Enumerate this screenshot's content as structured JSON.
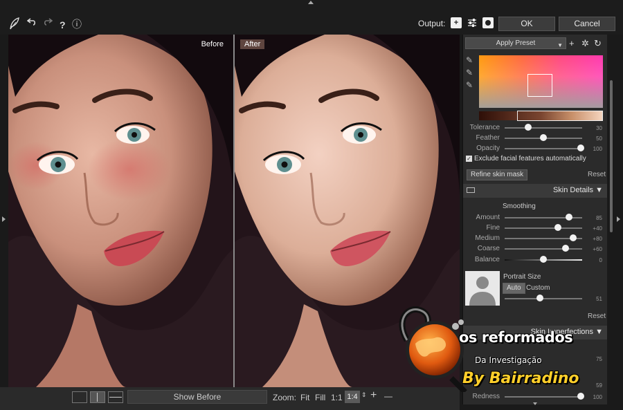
{
  "toolbar": {
    "output_label": "Output:",
    "ok_label": "OK",
    "cancel_label": "Cancel",
    "output_icons": [
      "plus-box-icon",
      "sliders-icon",
      "mask-icon"
    ],
    "left_icons": [
      "feather-logo-icon",
      "undo-icon",
      "redo-icon",
      "help-icon",
      "info-icon"
    ],
    "help_glyph": "?",
    "info_glyph": "ⓘ"
  },
  "viewer": {
    "before_label": "Before",
    "after_label": "After"
  },
  "bottom": {
    "show_before_label": "Show Before",
    "zoom_label": "Zoom:",
    "zoom_fit": "Fit",
    "zoom_fill": "Fill",
    "zoom_1_1": "1:1",
    "zoom_selected": "1:4",
    "zoom_in": "+",
    "zoom_out": "—"
  },
  "skin_mask": {
    "preset_label": "Apply Preset",
    "tolerance": {
      "label": "Tolerance",
      "value": "30",
      "level": 0.3
    },
    "feather": {
      "label": "Feather",
      "value": "50",
      "level": 0.5
    },
    "opacity": {
      "label": "Opacity",
      "value": "100",
      "level": 1.0
    },
    "exclude_label": "Exclude facial features automatically",
    "exclude_checked": true,
    "refine_label": "Refine skin mask",
    "reset_label": "Reset"
  },
  "skin_details": {
    "title": "Skin Details",
    "smoothing_title": "Smoothing",
    "amount": {
      "label": "Amount",
      "value": "85"
    },
    "fine": {
      "label": "Fine",
      "value": "+40"
    },
    "medium": {
      "label": "Medium",
      "value": "+80"
    },
    "coarse": {
      "label": "Coarse",
      "value": "+60"
    },
    "balance": {
      "label": "Balance",
      "value": "0"
    },
    "portrait_size_title": "Portrait Size",
    "auto_label": "Auto",
    "custom_label": "Custom",
    "portrait_value": "51",
    "reset_label": "Reset"
  },
  "skin_imperfections": {
    "title": "Skin Imperfections",
    "value1": "75",
    "value2": "59",
    "redness": {
      "label": "Redness",
      "value": "100"
    }
  },
  "watermark": {
    "line1": "os reformados",
    "line2": "Da Investigação",
    "line3": "By Bairradino"
  },
  "colors": {
    "panel_bg": "#2b2b2b",
    "toolbar_bg": "#1c1c1c",
    "watermark_yellow": "#ffcf2a"
  }
}
